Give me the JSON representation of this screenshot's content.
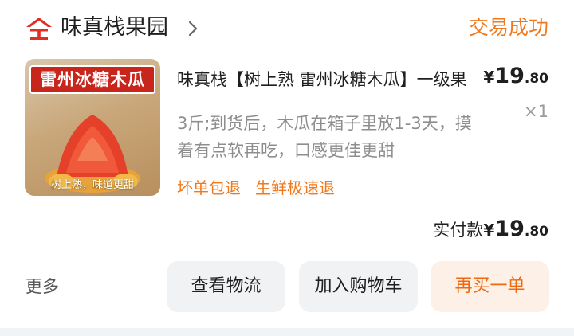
{
  "header": {
    "shop_logo_icon": "shop-logo-icon",
    "shop_name": "味真栈果园",
    "shop_arrow_icon": "chevron-right-icon",
    "status": "交易成功"
  },
  "item": {
    "thumbnail": {
      "banner_text": "雷州冰糖木瓜",
      "caption_text": "树上熟，味道更甜"
    },
    "title": "味真栈【树上熟 雷州冰糖木瓜】一级果",
    "price": {
      "currency": "¥",
      "integer": "19",
      "decimal": ".80"
    },
    "quantity": "×1",
    "description": "3斤;到货后，木瓜在箱子里放1-3天，摸着有点软再吃，口感更佳更甜",
    "tags": [
      "坏单包退",
      "生鲜极速退"
    ]
  },
  "total": {
    "label": "实付款",
    "currency": "¥",
    "integer": "19",
    "decimal": ".80"
  },
  "actions": {
    "more": "更多",
    "logistics": "查看物流",
    "add_cart": "加入购物车",
    "rebuy": "再买一单"
  },
  "colors": {
    "accent_orange": "#f0791d",
    "brand_red": "#e02e24",
    "button_gray": "#f1f2f4",
    "rebuy_bg": "#fdf0e6"
  }
}
